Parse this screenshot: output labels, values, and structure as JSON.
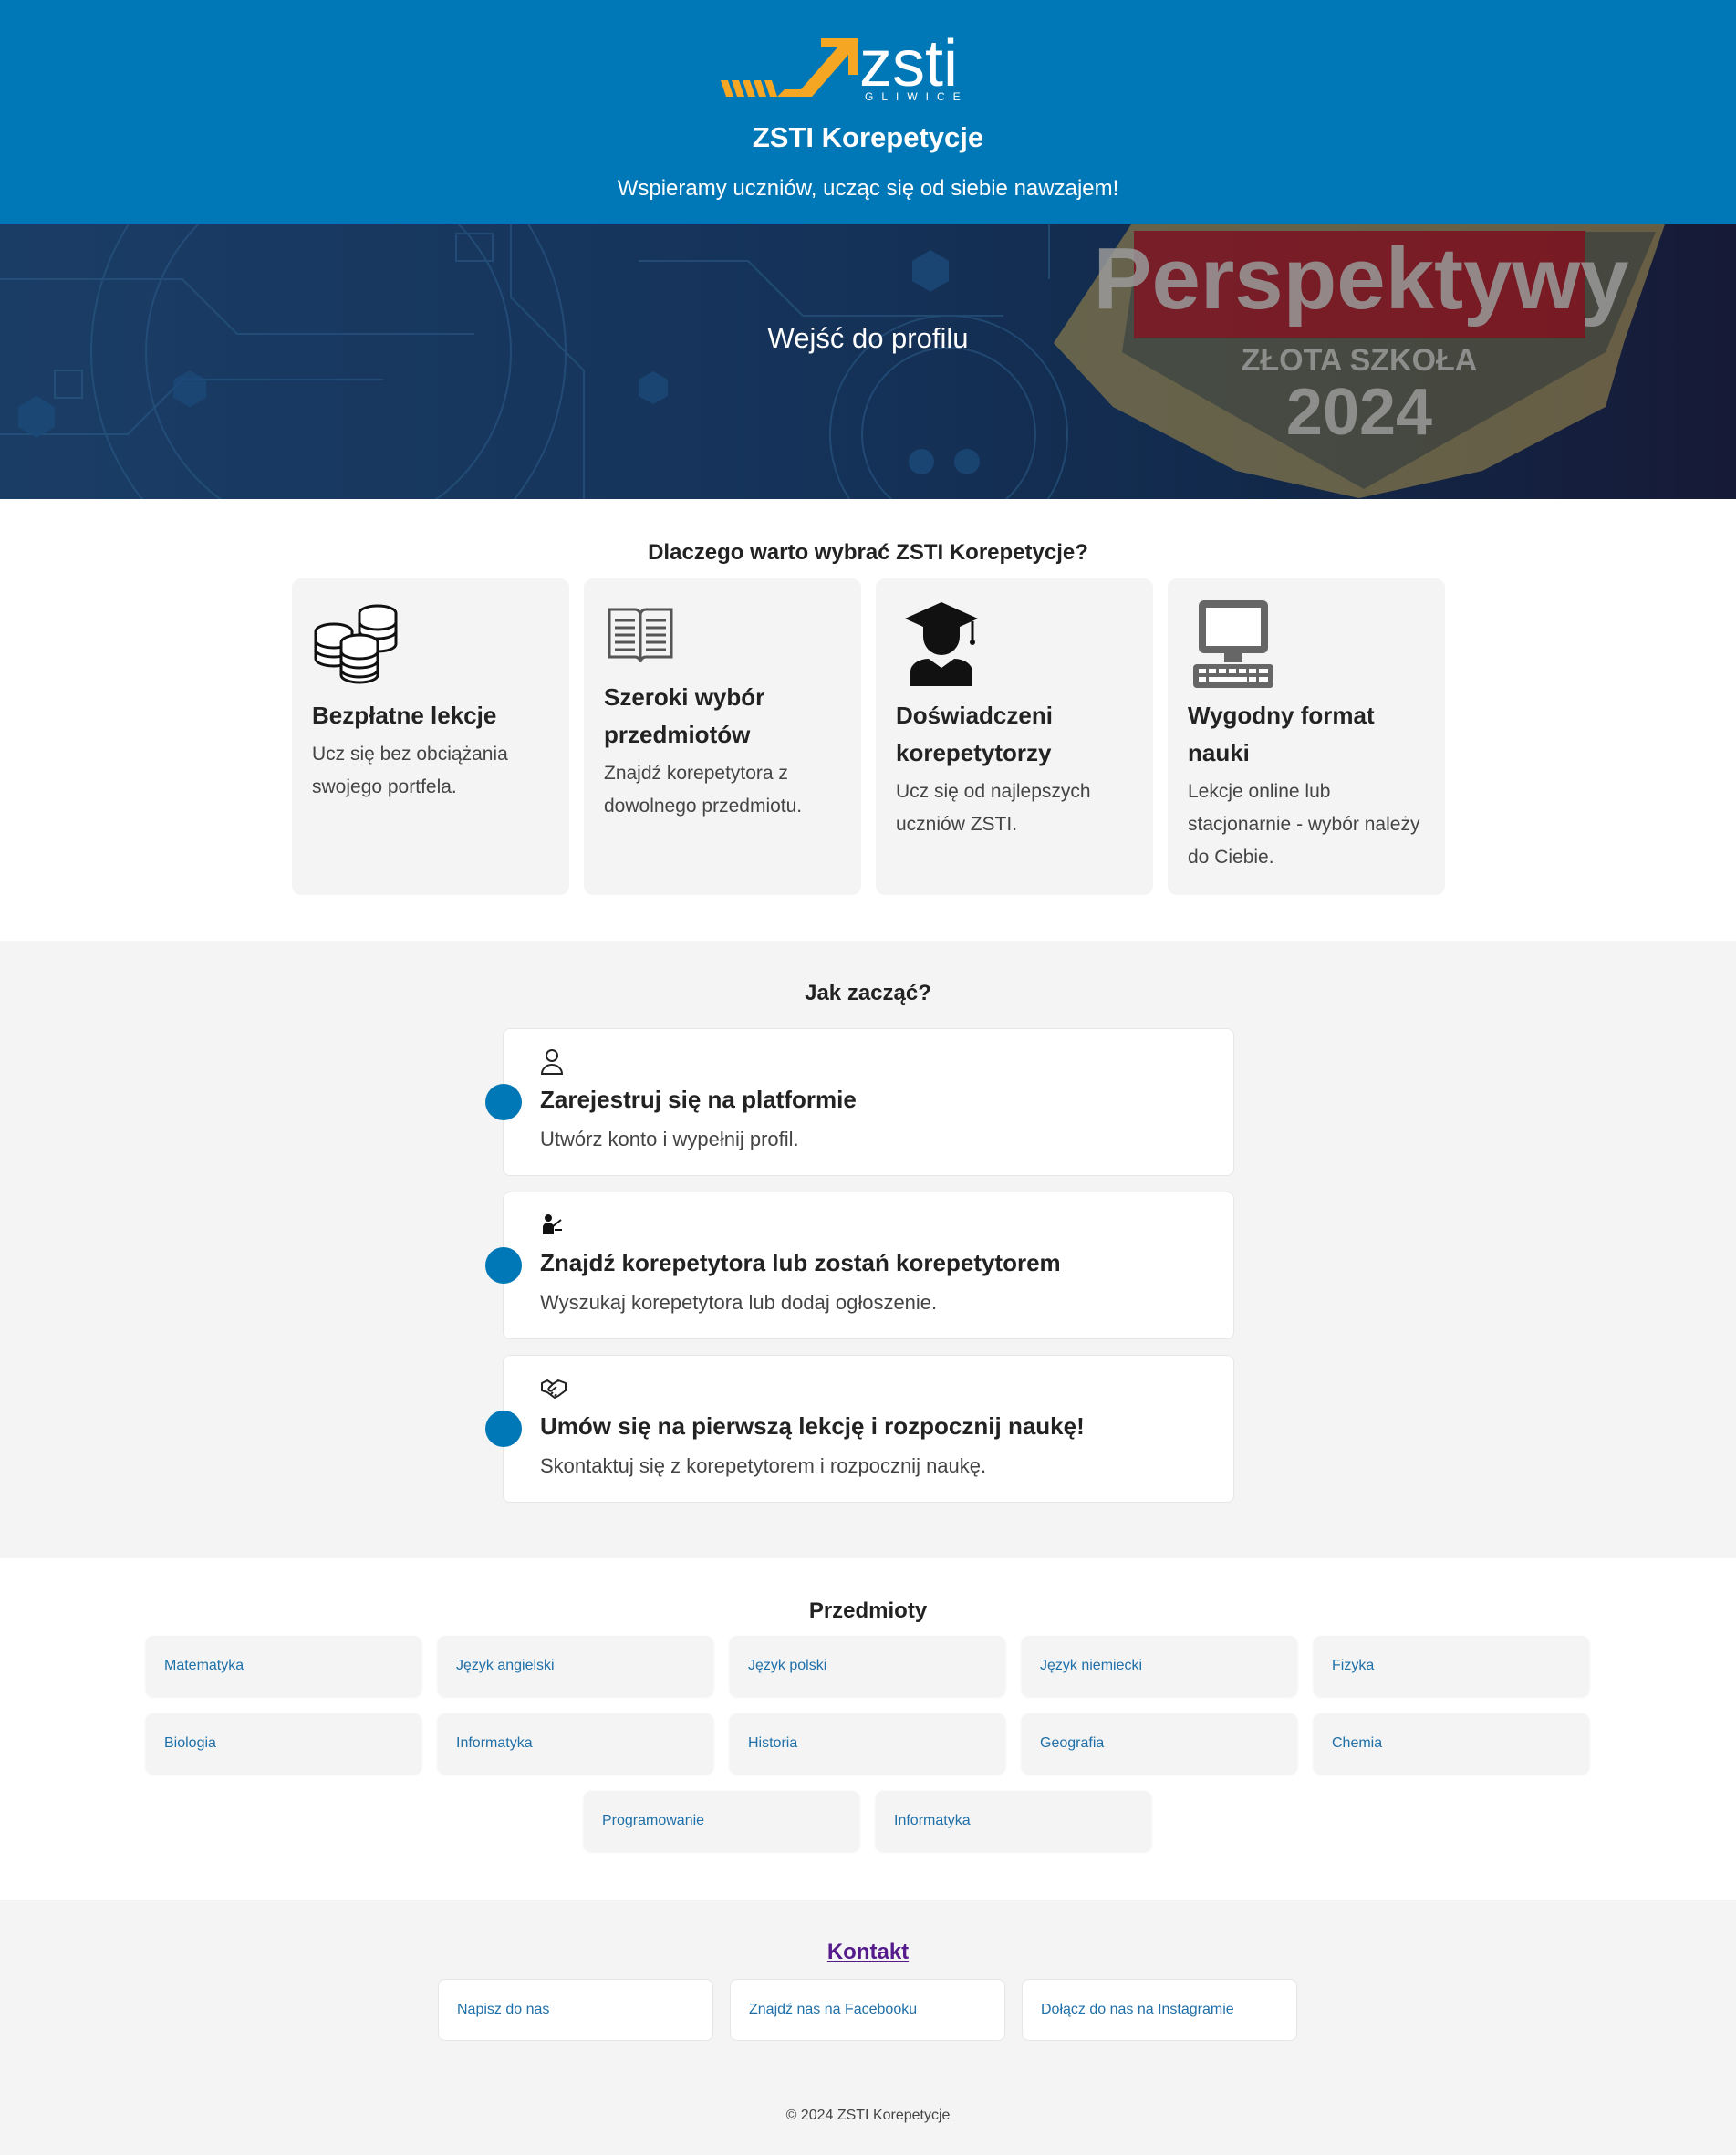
{
  "header": {
    "logo_text": "zsti",
    "logo_sub": "GLIWICE",
    "title": "ZSTI Korepetycje",
    "tagline": "Wspieramy uczniów, ucząc się od siebie nawzajem!"
  },
  "hero": {
    "link": "Wejść do profilu",
    "badge_title": "Perspektywy",
    "badge_sub": "ZŁOTA SZKOŁA",
    "badge_year": "2024"
  },
  "features": {
    "title": "Dlaczego warto wybrać ZSTI Korepetycje?",
    "items": [
      {
        "icon": "coins-icon",
        "title": "Bezpłatne lekcje",
        "text": "Ucz się bez obciążania swojego portfela."
      },
      {
        "icon": "book-icon",
        "title": "Szeroki wybór przedmiotów",
        "text": "Znajdź korepetytora z dowolnego przedmiotu."
      },
      {
        "icon": "graduate-icon",
        "title": "Doświadczeni korepetytorzy",
        "text": "Ucz się od najlepszych uczniów ZSTI."
      },
      {
        "icon": "computer-icon",
        "title": "Wygodny format nauki",
        "text": "Lekcje online lub stacjonarnie - wybór należy do Ciebie."
      }
    ]
  },
  "steps": {
    "title": "Jak zacząć?",
    "items": [
      {
        "icon": "user-icon",
        "title": "Zarejestruj się na platformie",
        "text": "Utwórz konto i wypełnij profil."
      },
      {
        "icon": "teacher-icon",
        "title": "Znajdź korepetytora lub zostań korepetytorem",
        "text": "Wyszukaj korepetytora lub dodaj ogłoszenie."
      },
      {
        "icon": "handshake-icon",
        "title": "Umów się na pierwszą lekcję i rozpocznij naukę!",
        "text": "Skontaktuj się z korepetytorem i rozpocznij naukę."
      }
    ]
  },
  "subjects": {
    "title": "Przedmioty",
    "items": [
      "Matematyka",
      "Język angielski",
      "Język polski",
      "Język niemiecki",
      "Fizyka",
      "Biologia",
      "Informatyka",
      "Historia",
      "Geografia",
      "Chemia",
      "Programowanie",
      "Informatyka"
    ]
  },
  "contact": {
    "title": "Kontakt",
    "items": [
      "Napisz do nas",
      "Znajdź nas na Facebooku",
      "Dołącz do nas na Instagramie"
    ]
  },
  "footer": {
    "copyright": "© 2024 ZSTI Korepetycje"
  },
  "colors": {
    "primary": "#0077b6",
    "section_bg": "#f4f4f4",
    "logo_accent": "#f5a623"
  }
}
